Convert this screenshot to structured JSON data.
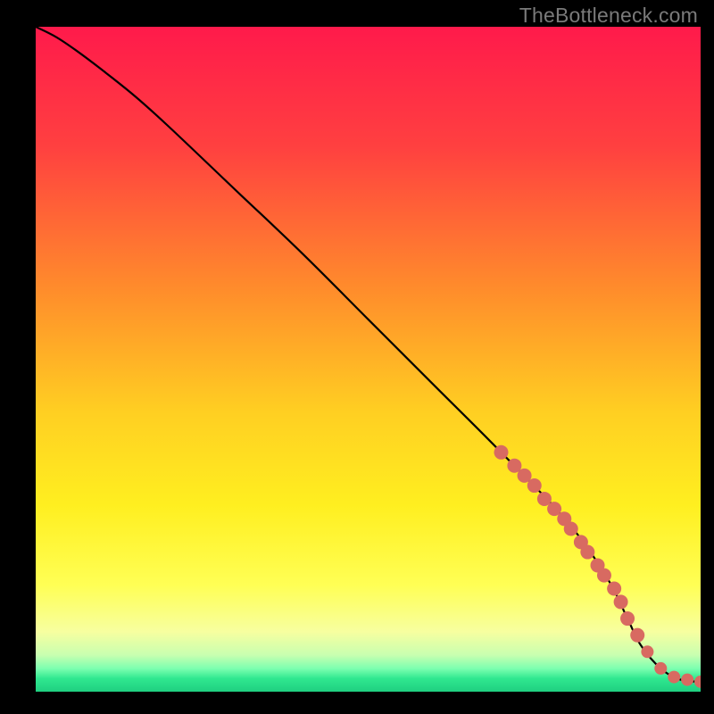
{
  "attribution": "TheBottleneck.com",
  "colors": {
    "background": "#000000",
    "gradient_stops": [
      {
        "offset": 0.0,
        "color": "#ff1a4b"
      },
      {
        "offset": 0.18,
        "color": "#ff4040"
      },
      {
        "offset": 0.4,
        "color": "#ff8e2b"
      },
      {
        "offset": 0.58,
        "color": "#ffcf22"
      },
      {
        "offset": 0.72,
        "color": "#ffef20"
      },
      {
        "offset": 0.84,
        "color": "#ffff55"
      },
      {
        "offset": 0.91,
        "color": "#f7ffa0"
      },
      {
        "offset": 0.945,
        "color": "#c8ffb0"
      },
      {
        "offset": 0.965,
        "color": "#7dffb0"
      },
      {
        "offset": 0.98,
        "color": "#30e890"
      },
      {
        "offset": 1.0,
        "color": "#1fcf80"
      }
    ],
    "curve": "#000000",
    "marker": "#d86a61"
  },
  "chart_data": {
    "type": "line",
    "title": "",
    "xlabel": "",
    "ylabel": "",
    "xlim": [
      0,
      100
    ],
    "ylim": [
      0,
      100
    ],
    "series": [
      {
        "name": "bottleneck-curve",
        "x": [
          0,
          3,
          6,
          10,
          15,
          20,
          30,
          40,
          50,
          60,
          70,
          80,
          86,
          89,
          91,
          94,
          97,
          100
        ],
        "y": [
          100,
          98.5,
          96.5,
          93.5,
          89.5,
          85,
          75.5,
          66,
          56,
          46,
          36,
          25.5,
          17,
          11,
          7,
          3.5,
          1.8,
          1.5
        ]
      }
    ],
    "markers": {
      "name": "highlighted-points",
      "x": [
        70,
        72,
        73.5,
        75,
        76.5,
        78,
        79.5,
        80.5,
        82,
        83,
        84.5,
        85.5,
        87,
        88,
        89,
        90.5,
        92,
        94,
        96,
        98,
        100
      ],
      "y": [
        36,
        34,
        32.5,
        31,
        29,
        27.5,
        26,
        24.5,
        22.5,
        21,
        19,
        17.5,
        15.5,
        13.5,
        11,
        8.5,
        6,
        3.5,
        2.2,
        1.8,
        1.5
      ],
      "radius": [
        8,
        8,
        8,
        8,
        8,
        8,
        8,
        8,
        8,
        8,
        8,
        8,
        8,
        8,
        8,
        8,
        7,
        7,
        7,
        7,
        7
      ]
    }
  }
}
